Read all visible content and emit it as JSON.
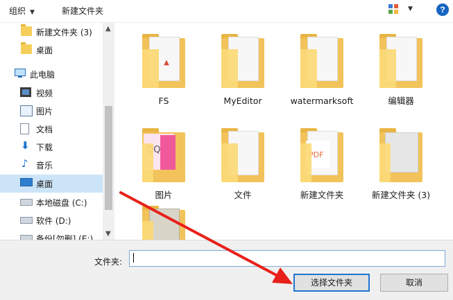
{
  "toolbar": {
    "organize_label": "组织",
    "new_folder_label": "新建文件夹"
  },
  "nav": {
    "items": [
      {
        "label": "新建文件夹 (3)",
        "icon": "folder-icon"
      },
      {
        "label": "桌面",
        "icon": "folder-icon"
      },
      {
        "label": "此电脑",
        "icon": "computer-icon"
      },
      {
        "label": "视频",
        "icon": "video-icon"
      },
      {
        "label": "图片",
        "icon": "picture-icon"
      },
      {
        "label": "文档",
        "icon": "document-icon"
      },
      {
        "label": "下载",
        "icon": "download-arrow-icon"
      },
      {
        "label": "音乐",
        "icon": "music-note-icon"
      },
      {
        "label": "桌面",
        "icon": "desktop-icon",
        "selected": true
      },
      {
        "label": "本地磁盘 (C:)",
        "icon": "windows-drive-icon"
      },
      {
        "label": "软件 (D:)",
        "icon": "drive-icon"
      },
      {
        "label": "备份[勿删] (E:)",
        "icon": "drive-icon"
      }
    ]
  },
  "content": {
    "files": [
      {
        "name": "FS"
      },
      {
        "name": "MyEditor"
      },
      {
        "name": "watermarksoft"
      },
      {
        "name": "编辑器"
      },
      {
        "name": "图片"
      },
      {
        "name": "文件"
      },
      {
        "name": "新建文件夹"
      },
      {
        "name": "新建文件夹 (3)"
      },
      {
        "name": ""
      }
    ]
  },
  "bottom": {
    "folder_label": "文件夹:",
    "folder_input_value": "",
    "select_button": "选择文件夹",
    "cancel_button": "取消"
  },
  "colors": {
    "accent": "#1f74d1",
    "annotation_arrow": "#e8201a",
    "selected_nav": "#cce4f7"
  }
}
